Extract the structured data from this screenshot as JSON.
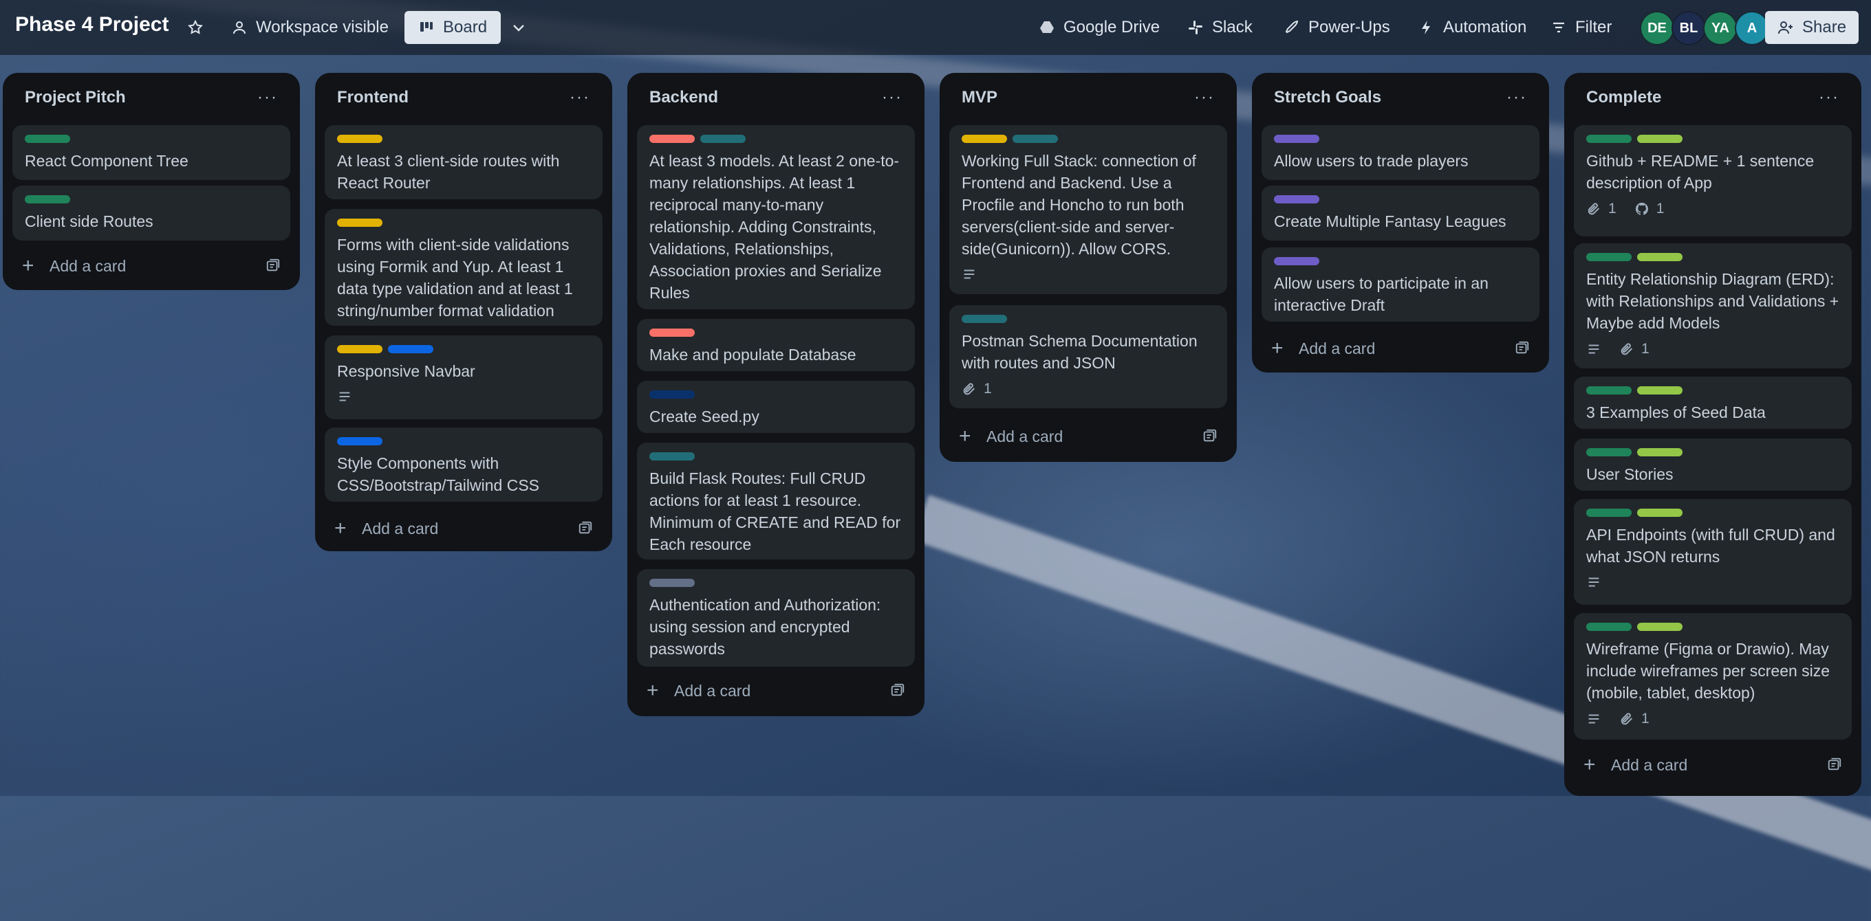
{
  "board": {
    "title": "Phase 4 Project",
    "visibility": "Workspace visible",
    "view": "Board"
  },
  "header": {
    "google_drive": "Google Drive",
    "slack": "Slack",
    "powerups": "Power-Ups",
    "automation": "Automation",
    "filter": "Filter",
    "share": "Share",
    "members": [
      {
        "initials": "DE",
        "color": "#1f845a"
      },
      {
        "initials": "BL",
        "color": "#1d2b4f"
      },
      {
        "initials": "YA",
        "color": "#1f845a"
      },
      {
        "initials": "A",
        "color": "#1d8fa6"
      }
    ]
  },
  "colors": {
    "green": "#1f845a",
    "lime": "#94c748",
    "yellow": "#e2b203",
    "blue": "#0c66e4",
    "navy": "#09326c",
    "red": "#f87168",
    "teal": "#216e78",
    "purple": "#6e5dc6",
    "gray": "#626f86"
  },
  "add_card_label": "Add a card",
  "lists": [
    {
      "title": "Project Pitch",
      "cards": [
        {
          "labels": [
            "green"
          ],
          "text": "React Component Tree"
        },
        {
          "labels": [
            "green"
          ],
          "text": "Client side Routes"
        }
      ]
    },
    {
      "title": "Frontend",
      "cards": [
        {
          "labels": [
            "yellow"
          ],
          "text": "At least 3 client-side routes with React Router"
        },
        {
          "labels": [
            "yellow"
          ],
          "text": "Forms with client-side validations using Formik and Yup. At least 1 data type validation and at least 1 string/number format validation"
        },
        {
          "labels": [
            "yellow",
            "blue"
          ],
          "text": "Responsive Navbar",
          "description": true
        },
        {
          "labels": [
            "blue"
          ],
          "text": "Style Components with CSS/Bootstrap/Tailwind CSS"
        }
      ]
    },
    {
      "title": "Backend",
      "cards": [
        {
          "labels": [
            "red",
            "teal"
          ],
          "text": "At least 3 models. At least 2 one-to-many relationships. At least 1 reciprocal many-to-many relationship. Adding Constraints, Validations, Relationships, Association proxies and Serialize Rules"
        },
        {
          "labels": [
            "red"
          ],
          "text": "Make and populate Database"
        },
        {
          "labels": [
            "navy"
          ],
          "text": "Create Seed.py"
        },
        {
          "labels": [
            "teal"
          ],
          "text": "Build Flask Routes: Full CRUD actions for at least 1 resource. Minimum of CREATE and READ for Each resource"
        },
        {
          "labels": [
            "gray"
          ],
          "text": "Authentication and Authorization: using session and encrypted passwords"
        }
      ]
    },
    {
      "title": "MVP",
      "cards": [
        {
          "labels": [
            "yellow",
            "teal"
          ],
          "text": "Working Full Stack: connection of Frontend and Backend. Use a Procfile and Honcho to run both servers(client-side and server-side(Gunicorn)). Allow CORS.",
          "description": true
        },
        {
          "labels": [
            "teal"
          ],
          "text": "Postman Schema Documentation with routes and JSON",
          "attachments": "1"
        }
      ]
    },
    {
      "title": "Stretch Goals",
      "cards": [
        {
          "labels": [
            "purple"
          ],
          "text": "Allow users to trade players"
        },
        {
          "labels": [
            "purple"
          ],
          "text": "Create Multiple Fantasy Leagues"
        },
        {
          "labels": [
            "purple"
          ],
          "text": "Allow users to participate in an interactive Draft"
        }
      ]
    },
    {
      "title": "Complete",
      "cards": [
        {
          "labels": [
            "green",
            "lime"
          ],
          "text": "Github + README + 1 sentence description of App",
          "attachments": "1",
          "github": "1"
        },
        {
          "labels": [
            "green",
            "lime"
          ],
          "text": "Entity Relationship Diagram (ERD): with Relationships and Validations + Maybe add Models",
          "description": true,
          "attachments": "1"
        },
        {
          "labels": [
            "green",
            "lime"
          ],
          "text": "3 Examples of Seed Data"
        },
        {
          "labels": [
            "green",
            "lime"
          ],
          "text": "User Stories"
        },
        {
          "labels": [
            "green",
            "lime"
          ],
          "text": "API Endpoints (with full CRUD) and what JSON returns",
          "description": true
        },
        {
          "labels": [
            "green",
            "lime"
          ],
          "text": "Wireframe (Figma or Drawio). May include wireframes per screen size (mobile, tablet, desktop)",
          "description": true,
          "attachments": "1"
        }
      ]
    }
  ]
}
